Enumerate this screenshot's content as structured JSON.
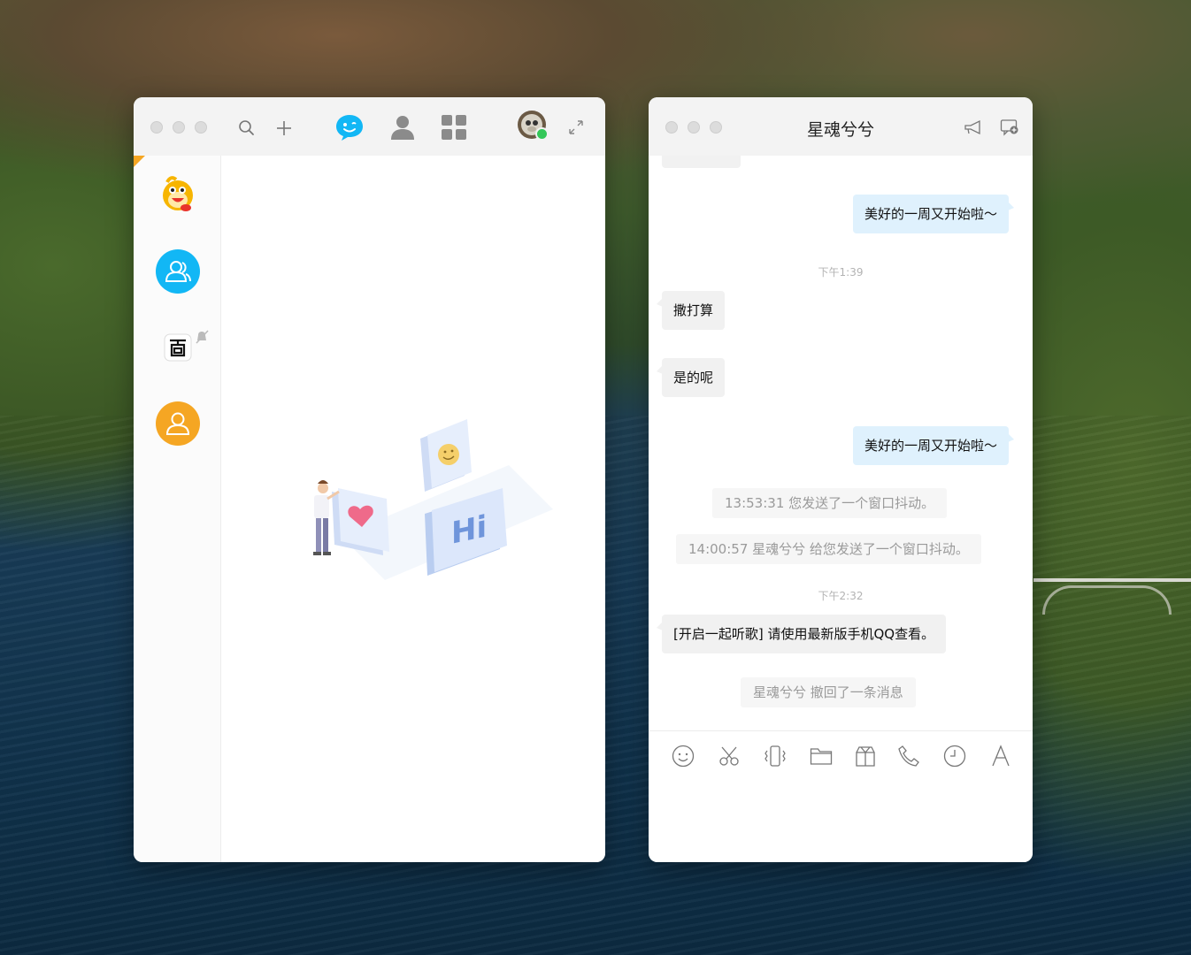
{
  "main_window": {
    "toolbar": {
      "search_icon": "search-icon",
      "add_icon": "plus-icon",
      "messages_icon": "qq-chat-icon",
      "contacts_icon": "contacts-icon",
      "apps_icon": "apps-grid-icon",
      "expand_icon": "expand-icon"
    },
    "sidebar": [
      "qq-mascot-avatar",
      "group-avatar-blue",
      "baidu-app-avatar",
      "group-avatar-orange"
    ],
    "empty_illustration": "chat-placeholder-illustration",
    "illustration_text": "Hi",
    "status_color": "#34c759",
    "accent_color": "#12b7f5"
  },
  "chat_window": {
    "title": "星魂兮兮",
    "messages": [
      {
        "type": "out",
        "text": "美好的一周又开始啦～"
      },
      {
        "type": "time",
        "text": "下午1:39"
      },
      {
        "type": "in",
        "text": "撒打算"
      },
      {
        "type": "in",
        "text": "是的呢"
      },
      {
        "type": "out",
        "text": "美好的一周又开始啦～"
      },
      {
        "type": "system",
        "text": "13:53:31 您发送了一个窗口抖动。"
      },
      {
        "type": "system",
        "text": "14:00:57 星魂兮兮 给您发送了一个窗口抖动。"
      },
      {
        "type": "time",
        "text": "下午2:32"
      },
      {
        "type": "in",
        "text": "[开启一起听歌] 请使用最新版手机QQ查看。"
      },
      {
        "type": "system",
        "text": "星魂兮兮 撤回了一条消息"
      }
    ],
    "toolbar": [
      "emoji-icon",
      "screenshot-scissors-icon",
      "shake-icon",
      "folder-icon",
      "gift-icon",
      "phone-icon",
      "history-clock-icon",
      "font-icon"
    ]
  }
}
